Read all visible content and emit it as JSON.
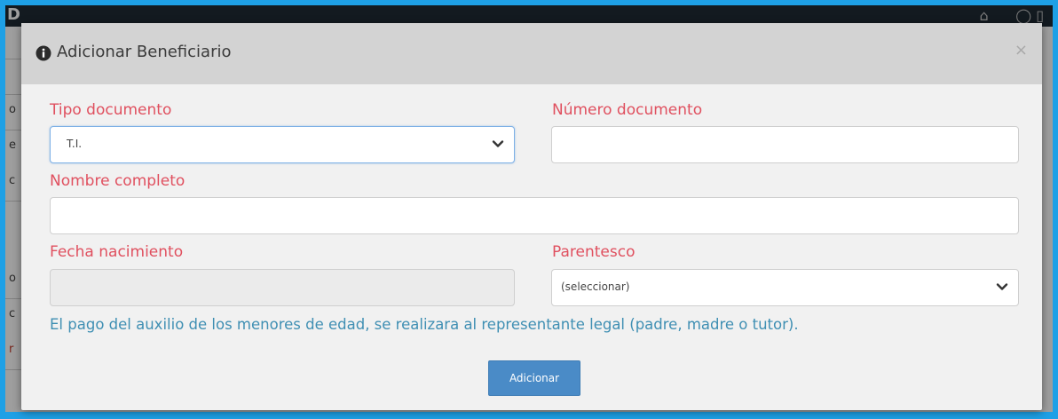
{
  "modal": {
    "title": "Adicionar Beneficiario",
    "close_label": "×",
    "tipo_documento": {
      "label": "Tipo documento",
      "value": "T.I."
    },
    "numero_documento": {
      "label": "Número documento",
      "value": ""
    },
    "nombre_completo": {
      "label": "Nombre completo",
      "value": ""
    },
    "fecha_nacimiento": {
      "label": "Fecha nacimiento",
      "value": ""
    },
    "parentesco": {
      "label": "Parentesco",
      "value": "(seleccionar)"
    },
    "note": "El pago del auxilio de los menores de edad, se realizara al representante legal (padre, madre o tutor).",
    "submit_label": "Adicionar"
  },
  "colors": {
    "frame": "#1ea0e6",
    "label": "#e0505f",
    "note": "#3f8fb3",
    "button": "#4a8bc7",
    "header": "#d3d3d3"
  },
  "icons": [
    "info-icon",
    "close-icon",
    "chevron-down-icon"
  ]
}
